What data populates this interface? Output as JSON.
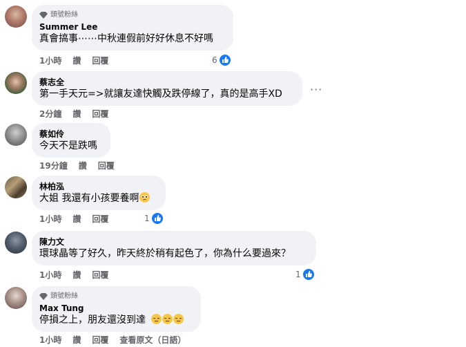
{
  "comments": [
    {
      "badge": "頭號粉絲",
      "author": "Summer Lee",
      "text": "真會搞事⋯⋯中秋連假前好好休息不好嗎",
      "time": "1小時",
      "like_label": "讚",
      "reply_label": "回覆",
      "reaction_count": "6"
    },
    {
      "author": "蔡志全",
      "text": "第一手天元=>就讓友達快觸及跌停線了，真的是高手XD",
      "time": "2分鐘",
      "like_label": "讚",
      "reply_label": "回覆",
      "more": "···"
    },
    {
      "author": "蔡如伶",
      "text": "今天不是跌嗎",
      "time": "19分鐘",
      "like_label": "讚",
      "reply_label": "回覆"
    },
    {
      "author": "林柏泓",
      "text": "大姐 我還有小孩要養啊",
      "time": "1小時",
      "like_label": "讚",
      "reply_label": "回覆",
      "reaction_count": "1"
    },
    {
      "author": "陳力文",
      "text": "環球晶等了好久，昨天終於稍有起色了，你為什么要過來？",
      "time": "1小時",
      "like_label": "讚",
      "reply_label": "回覆",
      "reaction_count": "1"
    },
    {
      "badge": "頭號粉絲",
      "author": "Max Tung",
      "text": "停損之上，朋友還沒到達",
      "time": "1小時",
      "like_label": "讚",
      "reply_label": "回覆",
      "see_original": "查看原文（日語）"
    }
  ],
  "colors": {
    "bubble": "#f0f2f5",
    "like_blue": "#1877f2",
    "meta_gray": "#65676b"
  }
}
